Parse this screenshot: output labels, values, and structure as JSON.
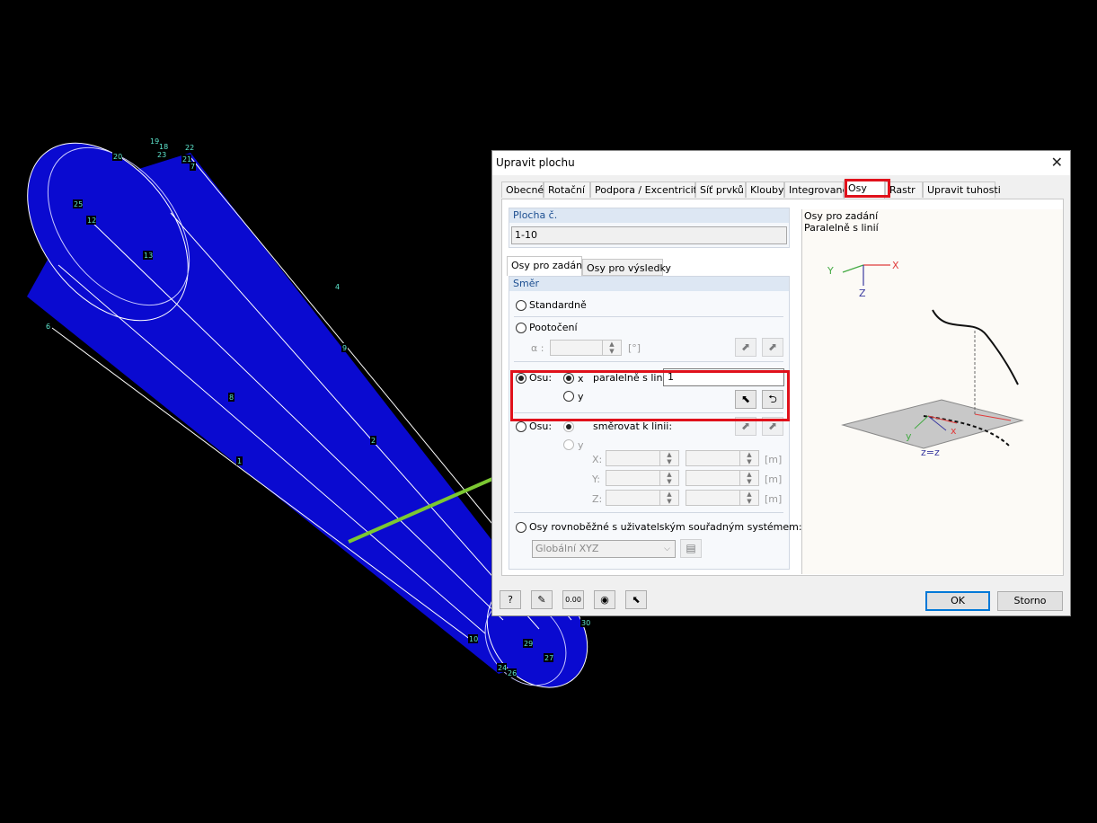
{
  "model": {
    "node_labels": [
      "19",
      "18",
      "22",
      "20",
      "23",
      "21",
      "7",
      "25",
      "12",
      "13",
      "4",
      "9",
      "6",
      "8",
      "2",
      "1",
      "10",
      "29",
      "24",
      "26",
      "27",
      "30"
    ]
  },
  "dialog": {
    "title": "Upravit plochu",
    "tabs": [
      "Obecné",
      "Rotační",
      "Podpora / Excentricita",
      "Síť prvků",
      "Klouby",
      "Integrované",
      "Osy",
      "Rastr",
      "Upravit tuhosti"
    ],
    "active_tab": "Osy",
    "surface_group_label": "Plocha č.",
    "surface_value": "1-10",
    "inner_tabs": [
      "Osy pro zadání",
      "Osy pro výsledky"
    ],
    "direction_label": "Směr",
    "standard_label": "Standardně",
    "rotation_label": "Pootočení",
    "alpha_label": "α :",
    "alpha_unit": "[°]",
    "axis_label_1": "Osu:",
    "x_label": "x",
    "y_label": "y",
    "parallel_label": "paralelně s linií:",
    "parallel_value": "1",
    "axis_label_2": "Osu:",
    "direct_label": "směrovat k linii:",
    "coord_labels": [
      "X:",
      "Y:",
      "Z:"
    ],
    "unit_m": "[m]",
    "user_cs_label": "Osy rovnoběžné s uživatelským souřadným systémem:",
    "cs_value": "Globální XYZ",
    "preview_line1": "Osy pro zadání",
    "preview_line2": "Paralelně s linií",
    "preview_axes": {
      "x": "X",
      "y": "Y",
      "z": "Z",
      "lx": "x",
      "ly": "y",
      "zz": "z=z"
    },
    "ok_label": "OK",
    "cancel_label": "Storno"
  },
  "colors": {
    "cylinder": "#0a0ad0",
    "highlight_red": "#e0111b",
    "arrow_green": "#7cc832"
  }
}
